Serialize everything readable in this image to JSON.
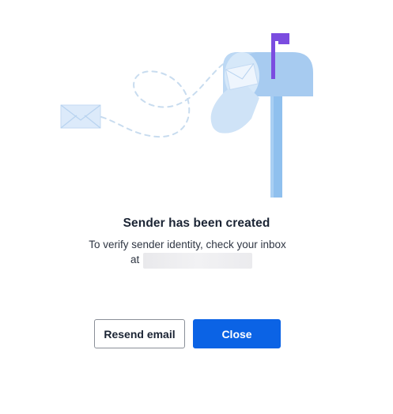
{
  "dialog": {
    "title": "Sender has been created",
    "message_line1": "To verify sender identity, check your inbox",
    "message_line2": "at",
    "email_redacted": "",
    "buttons": {
      "resend_label": "Resend email",
      "close_label": "Close"
    }
  },
  "illustration": {
    "name": "mailbox-illustration",
    "icons": [
      "envelope-icon",
      "mailbox-icon",
      "flag-icon"
    ]
  },
  "colors": {
    "primary": "#0b63e5",
    "text": "#1b2434",
    "mailbox_light": "#b3d4f2",
    "mailbox_mid": "#8fc0ee",
    "flag": "#7b4ce0"
  }
}
